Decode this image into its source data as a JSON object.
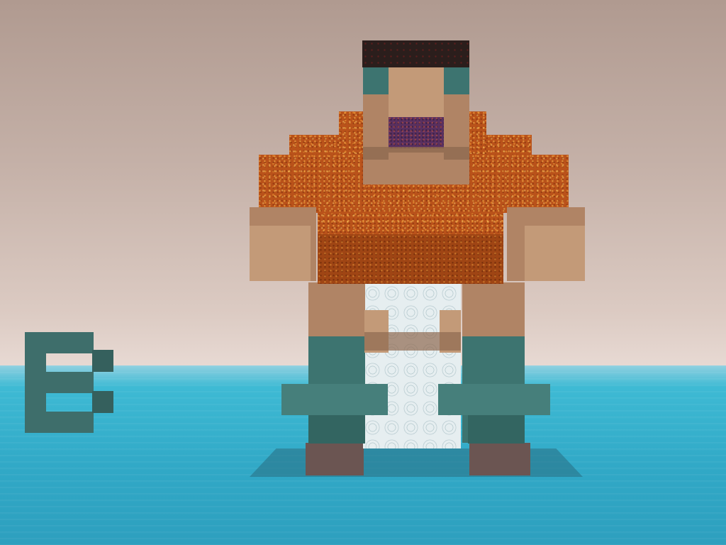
{
  "scene": {
    "colors": {
      "sky_top": "#b09a90",
      "sky_horizon": "#e8dad4",
      "water": "#31a9c7",
      "shirt": "#b9521a",
      "skin": "#b08465",
      "hair": "#2b1e1c",
      "teal": "#3d7470",
      "quartz": "#e6eef0",
      "boot": "#6b5552"
    },
    "figure": {
      "description_none": ""
    }
  }
}
